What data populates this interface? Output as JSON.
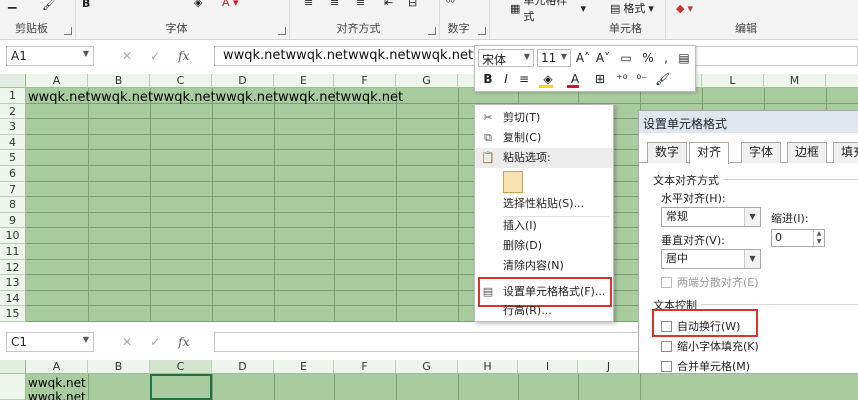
{
  "ribbon": {
    "groups": [
      "剪贴板",
      "字体",
      "对齐方式",
      "数字",
      "单元格",
      "编辑"
    ],
    "cell_style_label": "单元格样式",
    "format_label": "格式",
    "bold": "B",
    "italic": "I",
    "underline": "U",
    "colors": {
      "fill": "#ffd800",
      "font": "#e81123"
    }
  },
  "top": {
    "name_box": "A1",
    "formula": "wwqk.netwwqk.netwwqk.netwwqk.netwwqk.netwwqk.net",
    "fx": "fx",
    "columns": [
      "A",
      "B",
      "C",
      "D",
      "E",
      "F",
      "G",
      "",
      "",
      "",
      "",
      "L",
      "M"
    ],
    "rows": [
      "1",
      "2",
      "3",
      "4",
      "5",
      "6",
      "7",
      "8",
      "9",
      "10",
      "11",
      "12",
      "13",
      "14",
      "15"
    ],
    "a1_text": "wwqk.netwwqk.netwwqk.netwwqk.netwwqk.netwwqk.net"
  },
  "mini_toolbar": {
    "font": "宋体",
    "size": "11",
    "percent": "%",
    "comma": ",",
    "bold": "B",
    "italic": "I"
  },
  "context_menu": {
    "items": [
      {
        "label": "剪切(T)",
        "icon": "scissors-icon",
        "glyph": "✂"
      },
      {
        "label": "复制(C)",
        "icon": "copy-icon",
        "glyph": "⧉"
      },
      {
        "label": "粘贴选项:",
        "icon": "paste-icon",
        "glyph": "📋"
      },
      {
        "label": "选择性粘贴(S)...",
        "icon": "",
        "glyph": ""
      },
      {
        "label": "插入(I)",
        "icon": "",
        "glyph": ""
      },
      {
        "label": "删除(D)",
        "icon": "",
        "glyph": ""
      },
      {
        "label": "清除内容(N)",
        "icon": "",
        "glyph": ""
      },
      {
        "label": "设置单元格格式(F)...",
        "icon": "format-cells-icon",
        "glyph": "▤"
      },
      {
        "label": "行高(R)...",
        "icon": "",
        "glyph": ""
      }
    ]
  },
  "dialog": {
    "title": "设置单元格格式",
    "tabs": [
      "数字",
      "对齐",
      "字体",
      "边框",
      "填充"
    ],
    "section_alignment": "文本对齐方式",
    "horizontal_label": "水平对齐(H):",
    "horizontal_value": "常规",
    "indent_label": "缩进(I):",
    "indent_value": "0",
    "vertical_label": "垂直对齐(V):",
    "vertical_value": "居中",
    "distributed_label": "两端分散对齐(E)",
    "section_control": "文本控制",
    "wrap_label": "自动换行(W)",
    "shrink_label": "缩小字体填充(K)",
    "merge_label": "合并单元格(M)"
  },
  "bottom": {
    "name_box": "C1",
    "fx": "fx",
    "columns": [
      "A",
      "B",
      "C",
      "D",
      "E",
      "F",
      "G",
      "H",
      "I",
      "J"
    ],
    "a1_line1": "wwqk.net",
    "a1_line2": "wwqk.net"
  }
}
